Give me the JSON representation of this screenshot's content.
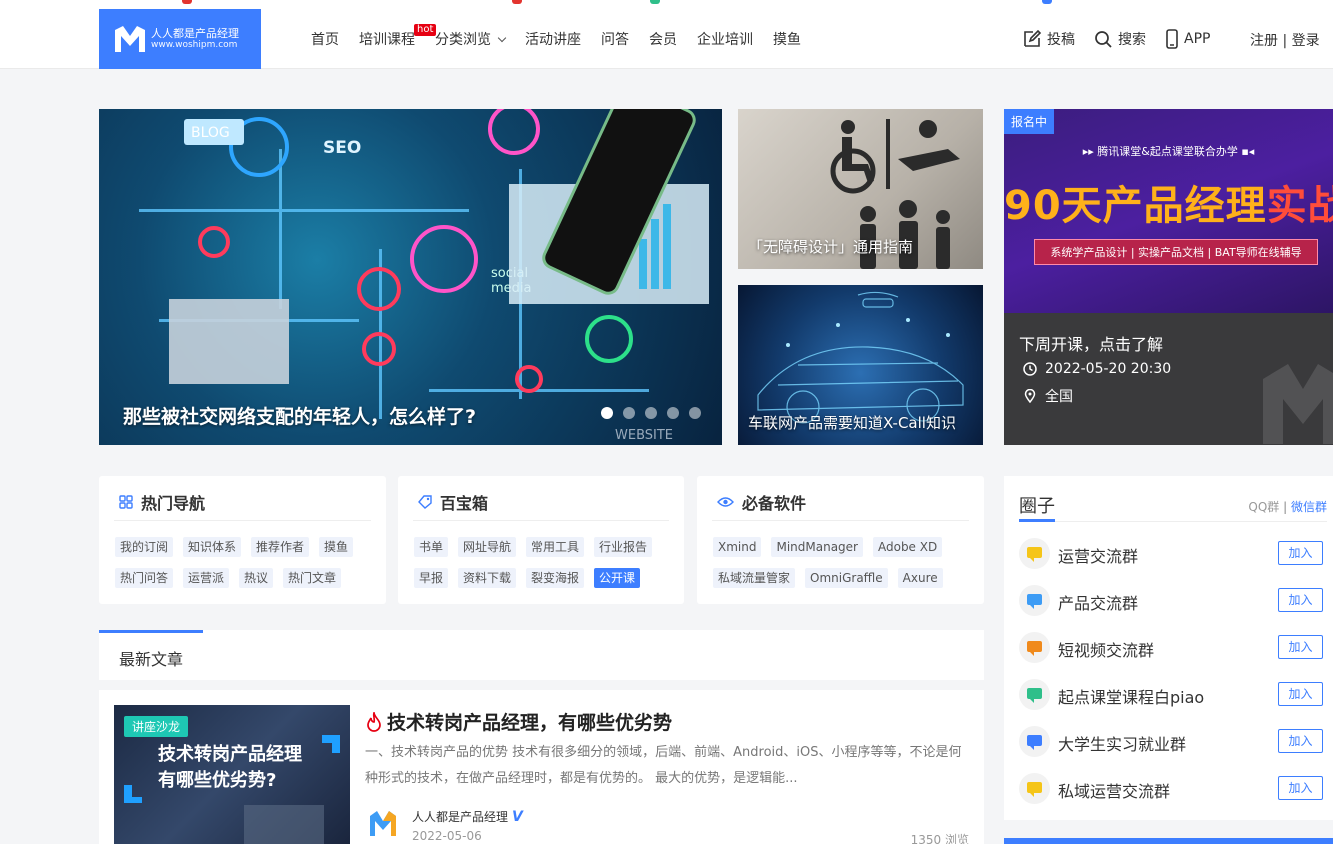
{
  "header": {
    "logo": {
      "line1": "人人都是产品经理",
      "line2": "www.woshipm.com"
    },
    "nav": [
      {
        "label": "首页"
      },
      {
        "label": "培训课程",
        "badge": "hot"
      },
      {
        "label": "分类浏览",
        "has_dropdown": true
      },
      {
        "label": "活动讲座"
      },
      {
        "label": "问答"
      },
      {
        "label": "会员"
      },
      {
        "label": "企业培训"
      },
      {
        "label": "摸鱼"
      }
    ],
    "tools": {
      "post": "投稿",
      "search": "搜索",
      "app": "APP"
    },
    "auth": "注册 | 登录"
  },
  "banner": {
    "main": {
      "title": "那些被社交网络支配的年轻人，怎么样了?",
      "slide_count": 5,
      "active_index": 0,
      "image_words": [
        "BLOG",
        "SEO",
        "social",
        "media",
        "WEBSITE"
      ]
    },
    "card_a": {
      "caption": "「无障碍设计」通用指南"
    },
    "card_b": {
      "caption": "车联网产品需要知道X-Call知识"
    },
    "promo": {
      "badge": "报名中",
      "subtitle": "▸▸ 腾讯课堂&起点课堂联合办学 ▪◂",
      "headline_a": "90天产品经理",
      "headline_b": "实战班",
      "strip": "系统学产品设计 | 实操产品文档 | BAT导师在线辅导",
      "title": "下周开课，点击了解",
      "datetime": "2022-05-20 20:30",
      "location": "全国"
    }
  },
  "boxes": [
    {
      "title": "热门导航",
      "icon": "grid-icon",
      "tags": [
        "我的订阅",
        "知识体系",
        "推荐作者",
        "摸鱼",
        "热门问答",
        "运营派",
        "热议",
        "热门文章"
      ],
      "active": -1
    },
    {
      "title": "百宝箱",
      "icon": "tag-icon",
      "tags": [
        "书单",
        "网址导航",
        "常用工具",
        "行业报告",
        "早报",
        "资料下载",
        "裂变海报",
        "公开课"
      ],
      "active": 7
    },
    {
      "title": "必备软件",
      "icon": "eye-icon",
      "tags": [
        "Xmind",
        "MindManager",
        "Adobe XD",
        "私域流量管家",
        "OmniGraffle",
        "Axure"
      ],
      "active": -1
    }
  ],
  "latest": {
    "title": "最新文章"
  },
  "article": {
    "badge": "讲座沙龙",
    "image_title": "技术转岗产品经理\n有哪些优劣势?",
    "title": "技术转岗产品经理，有哪些优劣势",
    "desc": "一、技术转岗产品的优势 技术有很多细分的领域，后端、前端、Android、iOS、小程序等等，不论是何种形式的技术，在做产品经理时，都是有优势的。 最大的优势，是逻辑能...",
    "author": "人人都是产品经理",
    "verified_mark": "V",
    "date": "2022-05-06",
    "views": "1350 浏览"
  },
  "circle": {
    "title": "圈子",
    "link_qq": "QQ群",
    "separator": "|",
    "link_wechat": "微信群",
    "groups": [
      {
        "name": "运营交流群",
        "button": "加入",
        "color": "#f5c518"
      },
      {
        "name": "产品交流群",
        "button": "加入",
        "color": "#3d9cf5"
      },
      {
        "name": "短视频交流群",
        "button": "加入",
        "color": "#f08a1c"
      },
      {
        "name": "起点课堂课程白piao",
        "button": "加入",
        "color": "#2fbf8a"
      },
      {
        "name": "大学生实习就业群",
        "button": "加入",
        "color": "#3d7eff"
      },
      {
        "name": "私域运营交流群",
        "button": "加入",
        "color": "#f5c518"
      }
    ]
  },
  "colors": {
    "accent": "#3d7eff",
    "hot": "#e60012"
  }
}
